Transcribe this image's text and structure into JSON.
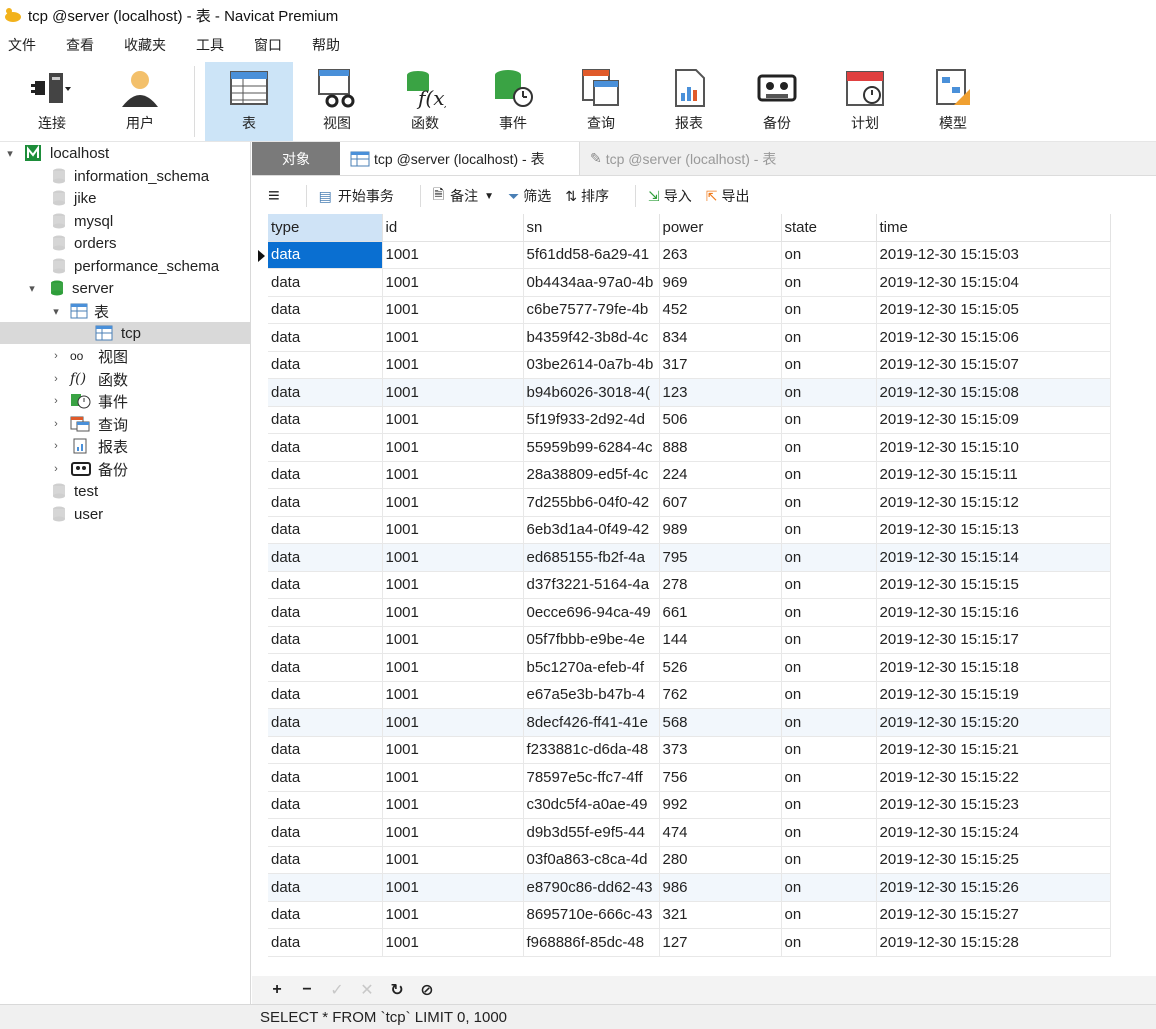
{
  "window": {
    "title": "tcp @server (localhost) - 表 - Navicat Premium"
  },
  "menu": [
    "文件",
    "查看",
    "收藏夹",
    "工具",
    "窗口",
    "帮助"
  ],
  "toolbar": {
    "connect": "连接",
    "user": "用户",
    "table": "表",
    "view": "视图",
    "function": "函数",
    "event": "事件",
    "query": "查询",
    "report": "报表",
    "backup": "备份",
    "schedule": "计划",
    "model": "模型"
  },
  "sidebar": {
    "connection": "localhost",
    "databases": [
      "information_schema",
      "jike",
      "mysql",
      "orders",
      "performance_schema"
    ],
    "server": "server",
    "tables_node": "表",
    "table": "tcp",
    "children": [
      "视图",
      "函数",
      "事件",
      "查询",
      "报表",
      "备份"
    ],
    "databases_after": [
      "test",
      "user"
    ]
  },
  "tabs": {
    "objects": "对象",
    "active": "tcp @server (localhost) - 表",
    "inactive": "tcp @server (localhost) - 表"
  },
  "grid_toolbar": {
    "begin_tx": "开始事务",
    "note": "备注",
    "filter": "筛选",
    "sort": "排序",
    "import": "导入",
    "export": "导出"
  },
  "grid": {
    "columns": [
      "type",
      "id",
      "sn",
      "power",
      "state",
      "time"
    ],
    "rows": [
      [
        "data",
        "1001",
        "5f61dd58-6a29-41",
        "263",
        "on",
        "2019-12-30 15:15:03"
      ],
      [
        "data",
        "1001",
        "0b4434aa-97a0-4b",
        "969",
        "on",
        "2019-12-30 15:15:04"
      ],
      [
        "data",
        "1001",
        "c6be7577-79fe-4b",
        "452",
        "on",
        "2019-12-30 15:15:05"
      ],
      [
        "data",
        "1001",
        "b4359f42-3b8d-4c",
        "834",
        "on",
        "2019-12-30 15:15:06"
      ],
      [
        "data",
        "1001",
        "03be2614-0a7b-4b",
        "317",
        "on",
        "2019-12-30 15:15:07"
      ],
      [
        "data",
        "1001",
        "b94b6026-3018-4(",
        "123",
        "on",
        "2019-12-30 15:15:08"
      ],
      [
        "data",
        "1001",
        "5f19f933-2d92-4d",
        "506",
        "on",
        "2019-12-30 15:15:09"
      ],
      [
        "data",
        "1001",
        "55959b99-6284-4c",
        "888",
        "on",
        "2019-12-30 15:15:10"
      ],
      [
        "data",
        "1001",
        "28a38809-ed5f-4c",
        "224",
        "on",
        "2019-12-30 15:15:11"
      ],
      [
        "data",
        "1001",
        "7d255bb6-04f0-42",
        "607",
        "on",
        "2019-12-30 15:15:12"
      ],
      [
        "data",
        "1001",
        "6eb3d1a4-0f49-42",
        "989",
        "on",
        "2019-12-30 15:15:13"
      ],
      [
        "data",
        "1001",
        "ed685155-fb2f-4a",
        "795",
        "on",
        "2019-12-30 15:15:14"
      ],
      [
        "data",
        "1001",
        "d37f3221-5164-4a",
        "278",
        "on",
        "2019-12-30 15:15:15"
      ],
      [
        "data",
        "1001",
        "0ecce696-94ca-49",
        "661",
        "on",
        "2019-12-30 15:15:16"
      ],
      [
        "data",
        "1001",
        "05f7fbbb-e9be-4e",
        "144",
        "on",
        "2019-12-30 15:15:17"
      ],
      [
        "data",
        "1001",
        "b5c1270a-efeb-4f",
        "526",
        "on",
        "2019-12-30 15:15:18"
      ],
      [
        "data",
        "1001",
        "e67a5e3b-b47b-4",
        "762",
        "on",
        "2019-12-30 15:15:19"
      ],
      [
        "data",
        "1001",
        "8decf426-ff41-41e",
        "568",
        "on",
        "2019-12-30 15:15:20"
      ],
      [
        "data",
        "1001",
        "f233881c-d6da-48",
        "373",
        "on",
        "2019-12-30 15:15:21"
      ],
      [
        "data",
        "1001",
        "78597e5c-ffc7-4ff",
        "756",
        "on",
        "2019-12-30 15:15:22"
      ],
      [
        "data",
        "1001",
        "c30dc5f4-a0ae-49",
        "992",
        "on",
        "2019-12-30 15:15:23"
      ],
      [
        "data",
        "1001",
        "d9b3d55f-e9f5-44",
        "474",
        "on",
        "2019-12-30 15:15:24"
      ],
      [
        "data",
        "1001",
        "03f0a863-c8ca-4d",
        "280",
        "on",
        "2019-12-30 15:15:25"
      ],
      [
        "data",
        "1001",
        "e8790c86-dd62-43",
        "986",
        "on",
        "2019-12-30 15:15:26"
      ],
      [
        "data",
        "1001",
        "8695710e-666c-43",
        "321",
        "on",
        "2019-12-30 15:15:27"
      ],
      [
        "data",
        "1001",
        "f968886f-85dc-48",
        "127",
        "on",
        "2019-12-30 15:15:28"
      ]
    ]
  },
  "bottom_toolbar": [
    "+",
    "−",
    "✓",
    "✕",
    "C",
    "⊘"
  ],
  "status": {
    "sql": "SELECT * FROM `tcp` LIMIT 0, 1000"
  },
  "colors": {
    "accent": "#0a6fd1",
    "selection": "#cce4f7",
    "green": "#2e9e3a",
    "red": "#e04040"
  }
}
